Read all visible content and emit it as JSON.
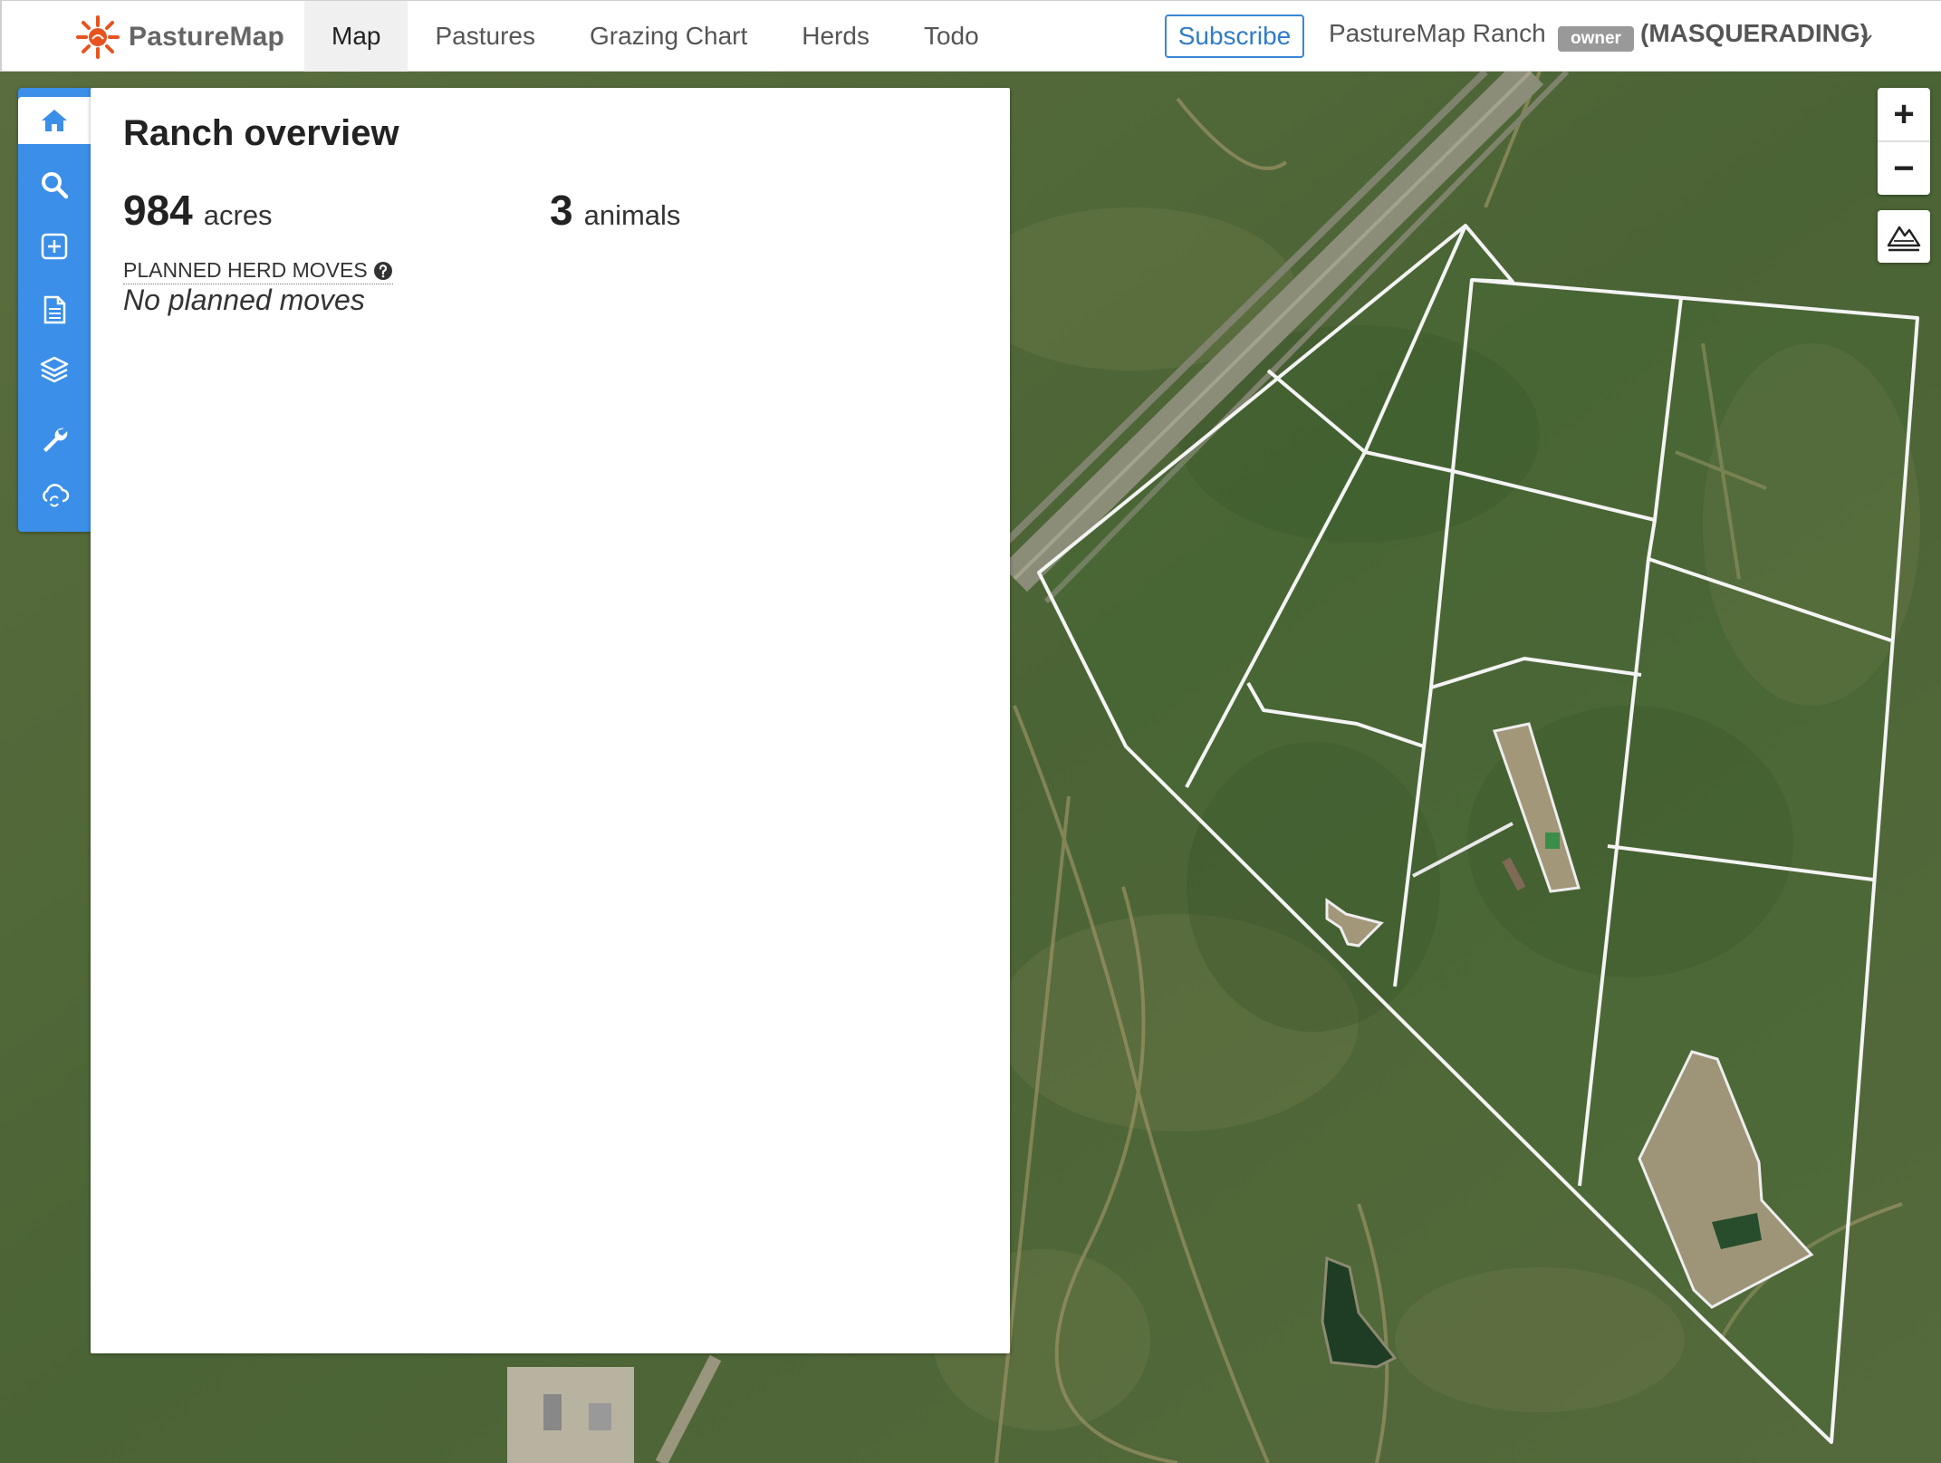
{
  "brand": {
    "name": "PastureMap",
    "logo_icon": "sun-logo-icon",
    "logo_color": "#e8531f"
  },
  "nav": {
    "items": [
      {
        "label": "Map",
        "active": true
      },
      {
        "label": "Pastures",
        "active": false
      },
      {
        "label": "Grazing Chart",
        "active": false
      },
      {
        "label": "Herds",
        "active": false
      },
      {
        "label": "Todo",
        "active": false
      }
    ]
  },
  "header": {
    "subscribe_label": "Subscribe",
    "ranch_name": "PastureMap Ranch",
    "role_badge": "owner",
    "masquerade_label": "(MASQUERADING)"
  },
  "toolbar": {
    "color": "#3b8fe8",
    "items": [
      {
        "icon": "home-icon",
        "active": true
      },
      {
        "icon": "search-icon",
        "active": false
      },
      {
        "icon": "add-square-icon",
        "active": false
      },
      {
        "icon": "document-icon",
        "active": false
      },
      {
        "icon": "layers-icon",
        "active": false
      },
      {
        "icon": "wrench-icon",
        "active": false
      },
      {
        "icon": "cloud-sync-icon",
        "active": false
      }
    ]
  },
  "panel": {
    "title": "Ranch overview",
    "acres_value": "984",
    "acres_unit": "acres",
    "animals_value": "3",
    "animals_unit": "animals",
    "planned_moves_label": "PLANNED HERD MOVES",
    "planned_moves_empty": "No planned moves"
  },
  "map_controls": {
    "zoom_in": "+",
    "zoom_out": "−",
    "terrain_icon": "terrain-icon"
  }
}
